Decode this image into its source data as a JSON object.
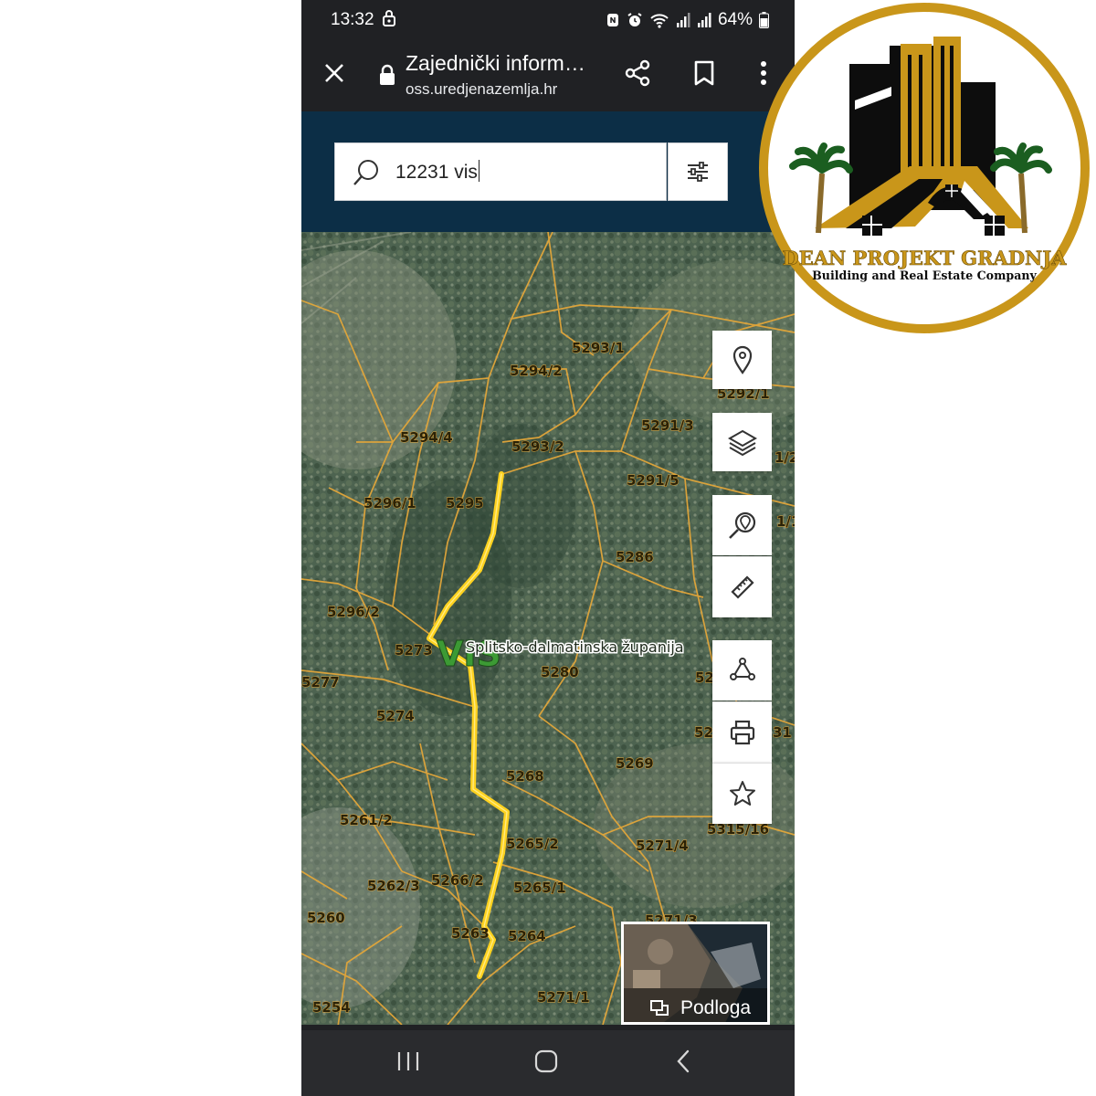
{
  "status_bar": {
    "time": "13:32",
    "battery": "64%",
    "icons": [
      "lock-icon",
      "nfc-icon",
      "alarm-icon",
      "wifi-icon",
      "signal-icon",
      "signal-icon",
      "battery-icon"
    ]
  },
  "browser": {
    "close_icon": "close-icon",
    "tab_title": "Zajednički inform…",
    "url": "oss.uredjenazemlja.hr",
    "share_icon": "share-icon",
    "bookmark_icon": "bookmark-icon",
    "menu_icon": "more-vert-icon"
  },
  "search": {
    "value": "12231 vis",
    "icon": "search-icon",
    "filter_icon": "filter-sliders-icon"
  },
  "map": {
    "region_label": "Splitsko-dalmatinska županija",
    "place_label": "VIS",
    "parcels": [
      "5293/1",
      "5294/2",
      "5292/1",
      "5291/3",
      "5294/4",
      "5293/2",
      "5291/5",
      "5296/1",
      "5295",
      "5286",
      "5296/2",
      "5273",
      "5280",
      "5277",
      "5274",
      "5268",
      "5269",
      "5261/2",
      "5265/2",
      "5271/4",
      "5315/16",
      "5262/3",
      "5266/2",
      "5265/1",
      "5260",
      "5263",
      "5264",
      "5271/3",
      "5271/1",
      "5254",
      "1/2",
      "1/1",
      "52",
      "52",
      "31"
    ],
    "route_color": "#ffd21f",
    "boundary_color": "#e2a63a"
  },
  "map_tools": [
    {
      "name": "location-pin-icon"
    },
    {
      "name": "layers-icon"
    },
    {
      "name": "search-location-icon"
    },
    {
      "name": "ruler-icon"
    },
    {
      "name": "polygon-measure-icon"
    },
    {
      "name": "print-icon"
    },
    {
      "name": "star-icon"
    }
  ],
  "basemap": {
    "label": "Podloga",
    "icon": "basemap-icon"
  },
  "nav_bar": {
    "icons": [
      "recent-apps-icon",
      "home-icon",
      "back-icon"
    ]
  },
  "logo": {
    "name": "DEAN PROJEKT GRADNJA",
    "tagline": "Building and Real Estate Company",
    "gold": "#c9961a",
    "dark": "#0d0d0d"
  }
}
